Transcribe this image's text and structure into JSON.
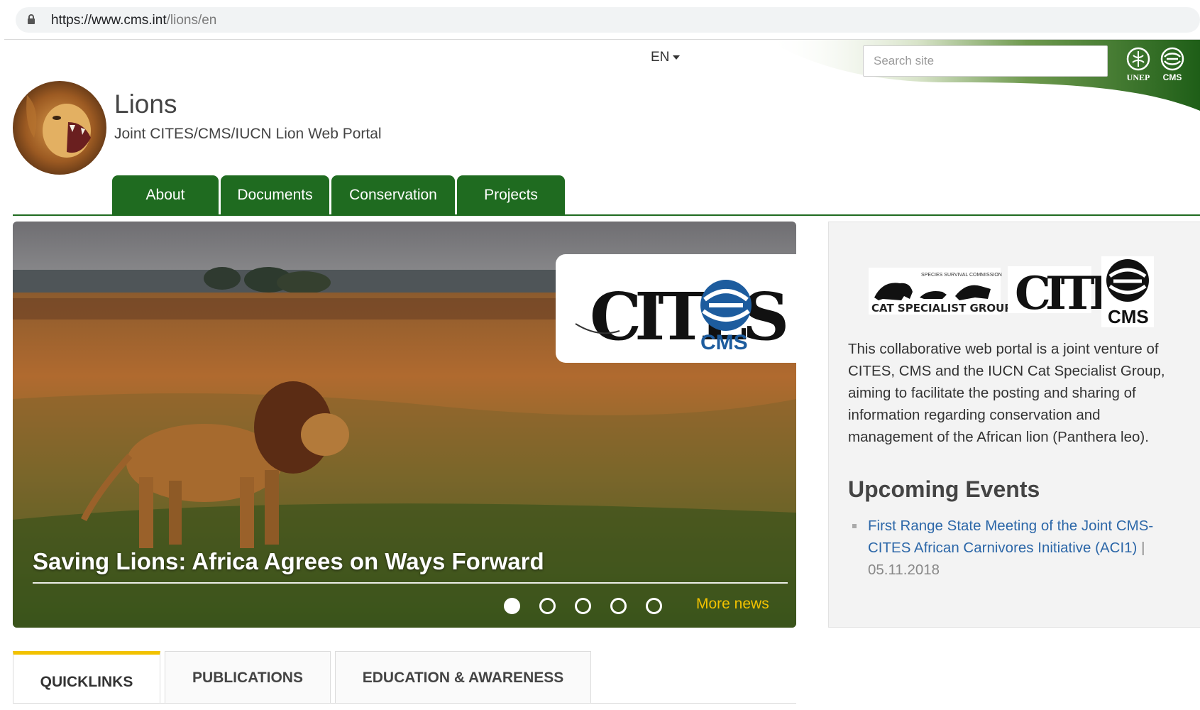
{
  "browser": {
    "url_host": "https://www.cms.int",
    "url_path": "/lions/en",
    "lock_icon": "lock-icon"
  },
  "header": {
    "language": "EN",
    "search_placeholder": "Search site",
    "unep_label": "UNEP",
    "cms_label": "CMS",
    "accent_color": "#1f6b20"
  },
  "site": {
    "title": "Lions",
    "subtitle": "Joint CITES/CMS/IUCN Lion Web Portal"
  },
  "nav": {
    "tabs": [
      {
        "label": "About"
      },
      {
        "label": "Documents"
      },
      {
        "label": "Conservation"
      },
      {
        "label": "Projects"
      }
    ]
  },
  "hero": {
    "title": "Saving Lions: Africa Agrees on Ways Forward",
    "slide_count": 5,
    "active_slide": 1,
    "more_news": "More news",
    "logo_cites": "CITES",
    "logo_cms": "CMS"
  },
  "sidebar": {
    "cat_group_caption": "SPECIES SURVIVAL COMMISSION",
    "cat_group_label": "CAT SPECIALIST GROUP",
    "cites_label": "CITES",
    "cms_label": "CMS",
    "about_text": "This collaborative web portal is a joint venture of CITES, CMS and the IUCN Cat Specialist Group, aiming to facilitate the posting and sharing of information regarding conservation and management of the African lion (Panthera leo).",
    "events_title": "Upcoming Events",
    "events": [
      {
        "title": "First Range State Meeting of the Joint CMS-CITES African Carnivores Initiative (ACI1)",
        "separator": "|",
        "date": "05.11.2018"
      }
    ]
  },
  "bottom_tabs": [
    {
      "label": "QUICKLINKS",
      "active": true
    },
    {
      "label": "PUBLICATIONS",
      "active": false
    },
    {
      "label": "EDUCATION & AWARENESS",
      "active": false
    }
  ]
}
